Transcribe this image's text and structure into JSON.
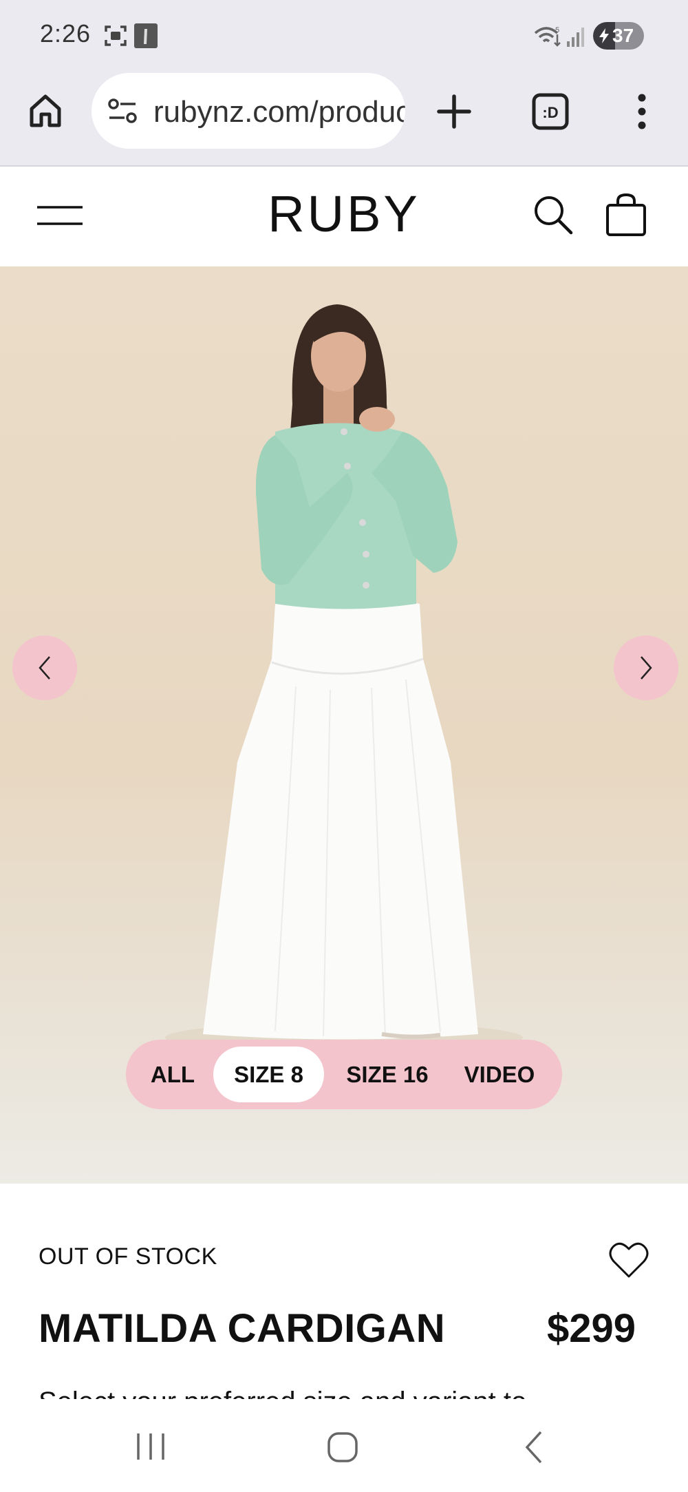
{
  "status_bar": {
    "time": "2:26",
    "battery_level": "37",
    "icons": [
      "screenshot-icon",
      "gallery-icon",
      "wifi-icon",
      "signal-icon",
      "battery-icon"
    ]
  },
  "browser": {
    "url": "rubynz.com/products/matilda-cardigan",
    "icons": [
      "home-icon",
      "site-info-icon",
      "new-tab-icon",
      "tab-switcher-icon",
      "more-menu-icon"
    ]
  },
  "site": {
    "brand": "RUBY",
    "icons": [
      "menu-icon",
      "search-icon",
      "bag-icon"
    ]
  },
  "gallery": {
    "filters": [
      {
        "label": "ALL",
        "active": false
      },
      {
        "label": "SIZE 8",
        "active": true
      },
      {
        "label": "SIZE 16",
        "active": false
      },
      {
        "label": "VIDEO",
        "active": false
      }
    ],
    "accent_color": "#f4c4cc"
  },
  "product": {
    "stock_status": "OUT OF STOCK",
    "name": "MATILDA CARDIGAN",
    "price": "$299",
    "description_preview": "Select your preferred size and variant to"
  },
  "nav": {
    "icons": [
      "recent-apps-icon",
      "home-button-icon",
      "back-icon"
    ]
  }
}
